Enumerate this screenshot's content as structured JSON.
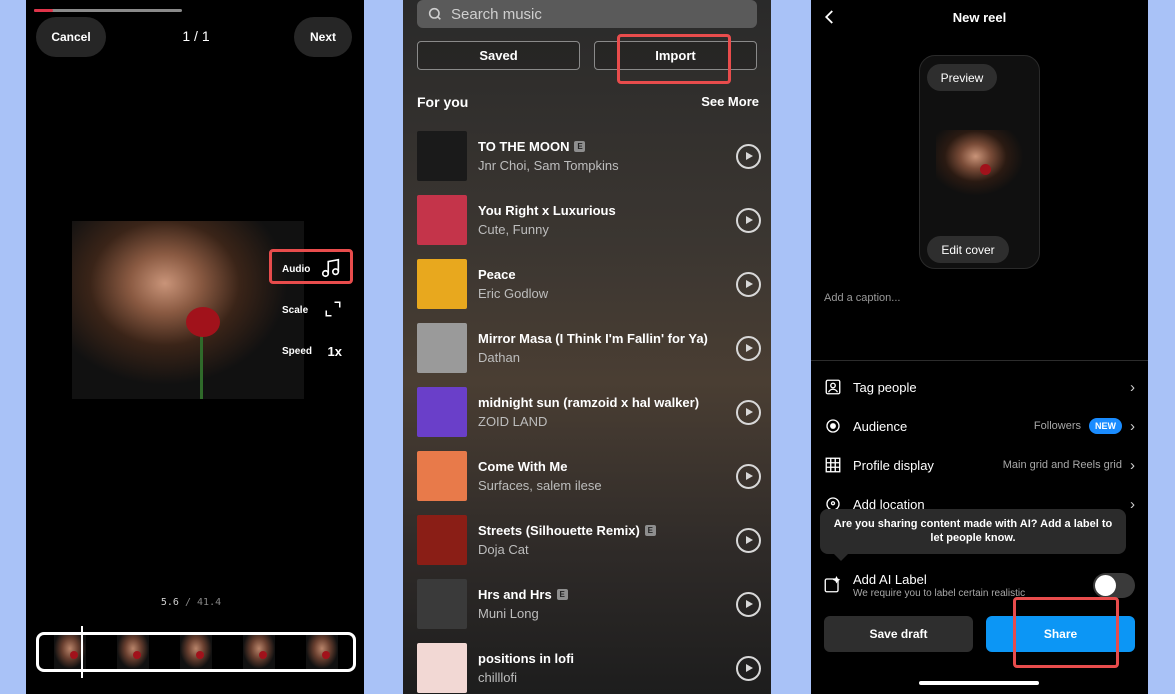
{
  "editor": {
    "cancel_label": "Cancel",
    "next_label": "Next",
    "counter": "1 / 1",
    "progress": 0.13,
    "tools": [
      {
        "label": "Audio",
        "icon": "music-note-icon"
      },
      {
        "label": "Scale",
        "icon": "expand-icon"
      },
      {
        "label": "Speed",
        "icon": "1x"
      }
    ],
    "time_current": "5.6",
    "time_sep": "/",
    "time_total": "41.4",
    "accent": "#e0344a",
    "highlight": "#e84c4c"
  },
  "music": {
    "search_placeholder": "Search music",
    "tabs": [
      "Saved",
      "Import"
    ],
    "section_title": "For you",
    "see_more": "See More",
    "explicit_mark": "E",
    "tracks": [
      {
        "title": "TO THE MOON",
        "artist": "Jnr Choi, Sam Tompkins",
        "explicit": true,
        "art": "#1a1a1a"
      },
      {
        "title": "You Right x Luxurious",
        "artist": "Cute, Funny",
        "explicit": false,
        "art": "#c4344a"
      },
      {
        "title": "Peace",
        "artist": "Eric Godlow",
        "explicit": false,
        "art": "#e8a81e"
      },
      {
        "title": "Mirror Masa (I Think I'm Fallin' for Ya)",
        "artist": "Dathan",
        "explicit": false,
        "art": "#9a9a9a"
      },
      {
        "title": "midnight sun (ramzoid x hal walker)",
        "artist": "ZOID LAND",
        "explicit": false,
        "art": "#6a3fc9"
      },
      {
        "title": "Come With Me",
        "artist": "Surfaces, salem ilese",
        "explicit": false,
        "art": "#e87a4a"
      },
      {
        "title": "Streets (Silhouette Remix)",
        "artist": "Doja Cat",
        "explicit": true,
        "art": "#8a1e16"
      },
      {
        "title": "Hrs and Hrs",
        "artist": "Muni Long",
        "explicit": true,
        "art": "#3a3a3a"
      },
      {
        "title": "positions in lofi",
        "artist": "chilllofi",
        "explicit": false,
        "art": "#f2d8d4"
      }
    ]
  },
  "reel": {
    "title": "New reel",
    "preview_label": "Preview",
    "edit_cover_label": "Edit cover",
    "caption_placeholder": "Add a caption...",
    "rows": [
      {
        "label": "Tag people",
        "value": "",
        "icon": "tag-person-icon"
      },
      {
        "label": "Audience",
        "value": "Followers",
        "badge": "NEW",
        "icon": "audience-icon"
      },
      {
        "label": "Profile display",
        "value": "Main grid and Reels grid",
        "icon": "grid-icon"
      },
      {
        "label": "Add location",
        "value": "",
        "icon": "location-icon"
      }
    ],
    "tooltip": "Are you sharing content made with AI? Add a label to let people know.",
    "ai_label_title": "Add AI Label",
    "ai_label_sub": "We require you to label certain realistic",
    "save_draft_label": "Save draft",
    "share_label": "Share",
    "share_color": "#0c96f5",
    "badge_color": "#1a8cff"
  }
}
